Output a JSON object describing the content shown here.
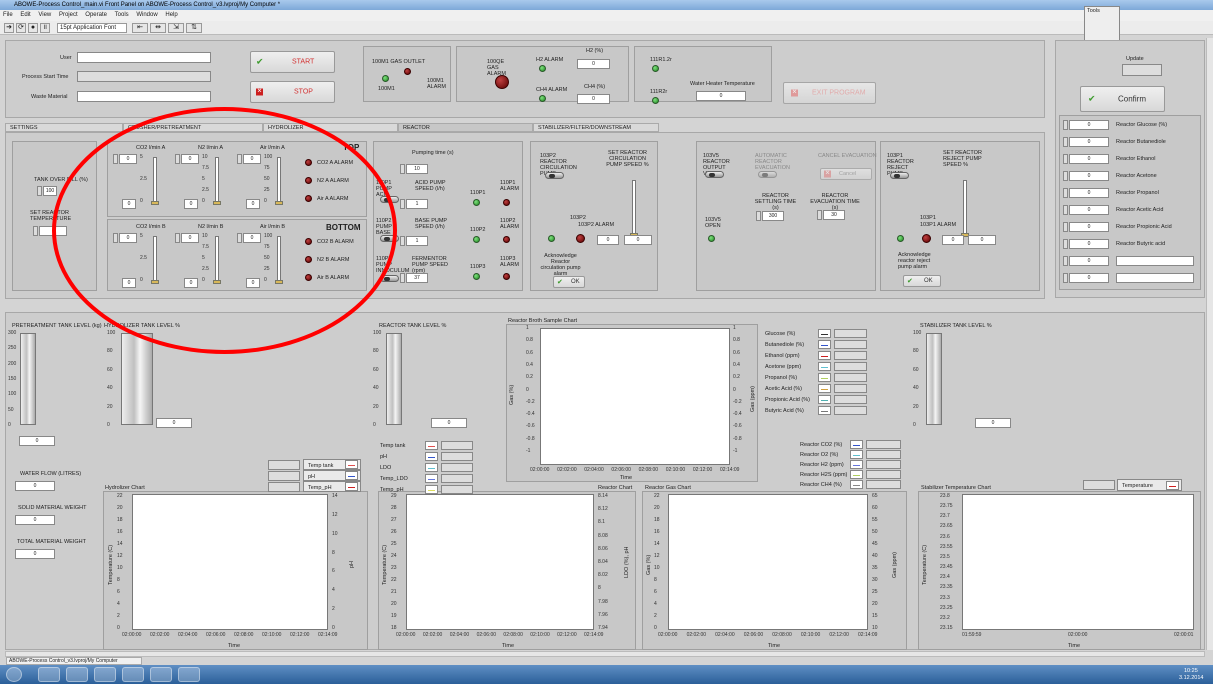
{
  "window": {
    "title": "ABOWE-Process Control_main.vi Front Panel on ABOWE-Process Control_v3.lvproj/My Computer *"
  },
  "menu": [
    "File",
    "Edit",
    "View",
    "Project",
    "Operate",
    "Tools",
    "Window",
    "Help"
  ],
  "toolbar": {
    "font": "15pt Application Font"
  },
  "header": {
    "user_label": "User",
    "start_time_label": "Process Start Time",
    "waste_label": "Waste Material",
    "start_label": "START",
    "stop_label": "STOP",
    "gas_outlet_title": "100M1 GAS OUTLET",
    "gas_outlet_led": "100M1",
    "gas_outlet_alarm": "100M1 ALARM",
    "gas_alarm_title": "100QE GAS ALARM",
    "h2_alarm": "H2 ALARM",
    "h2_pct": "H2 (%)",
    "h2_val": "0",
    "ch4_alarm": "CH4 ALARM",
    "ch4_pct": "CH4 (%)",
    "ch4_val": "0",
    "r111": "111R1.2r",
    "r111b": "111R2r",
    "water_heater": "Water Heater Temperature",
    "water_heater_val": "0",
    "exit_label": "EXIT PROGRAM",
    "update_label": "Update",
    "confirm_label": "Confirm"
  },
  "tabs": [
    "SETTINGS",
    "CRUSHER/PRETREATMENT",
    "HYDROLIZER",
    "REACTOR",
    "STABILIZER/FILTER/DOWNSTREAM CONTAINER"
  ],
  "settings": {
    "tank_over_fill": "TANK OVER FILL (%)",
    "tank_over_fill_val": "100",
    "set_reactor_temp": "SET REACTOR TEMPERATURE"
  },
  "crusher": {
    "top": "TOP",
    "bottom": "BOTTOM",
    "co2a": "CO2 l/min A",
    "n2a": "N2 l/min A",
    "aira": "Air l/min A",
    "co2b": "CO2 l/min B",
    "n2b": "N2 l/min B",
    "airb": "Air l/min B",
    "co2a_alarm": "CO2 A ALARM",
    "n2a_alarm": "N2 A ALARM",
    "aira_alarm": "Air A ALARM",
    "co2b_alarm": "CO2 B ALARM",
    "n2b_alarm": "N2 B ALARM",
    "airb_alarm": "Air B ALARM",
    "scale_a": [
      "5",
      "2.5",
      "0"
    ],
    "scale_b": [
      "10",
      "7.5",
      "5",
      "2.5",
      "0"
    ],
    "scale_c": [
      "100",
      "75",
      "50",
      "25",
      "0"
    ],
    "zero": "0"
  },
  "reactor": {
    "pumping_time": "Pumping time (s)",
    "pumping_val": "10",
    "p1_label": "110P1 PUMP ACID",
    "p1_speed": "ACID PUMP SPEED (l/h)",
    "p1_val": "1",
    "p1_led": "110P1",
    "p1_alarm": "110P1 ALARM",
    "p2_label": "110P2 PUMP BASE",
    "p2_speed": "BASE PUMP SPEED (l/h)",
    "p2_val": "1",
    "p2_led": "110P2",
    "p2_alarm": "110P2 ALARM",
    "p3_label": "110P3 PUMP INNOCULUM",
    "p3_speed": "FERMENTOR PUMP SPEED (rpm)",
    "p3_val": "37",
    "p3_led": "110P3",
    "p3_alarm": "110P3 ALARM",
    "circ_pump": "103P2 REACTOR CIRCULATION PUMP",
    "circ_speed": "SET REACTOR CIRCULATION PUMP SPEED %",
    "circ_led": "103P2",
    "circ_alarm": "103P2 ALARM",
    "circ_v1": "0",
    "circ_v2": "0",
    "ack_circ": "Acknowledge Reactor circulation pump alarm",
    "ok": "OK",
    "out_valve": "103V5 REACTOR OUTPUT VALVE",
    "auto_evac": "AUTOMATIC REACTOR EVACUATION",
    "cancel_evac": "CANCEL EVACUATION",
    "cancel": "Cancel",
    "settle": "REACTOR SETTLING TIME (s)",
    "settle_val": "300",
    "evac_time": "REACTOR EVACUATION TIME (s)",
    "evac_val": "30",
    "v5_open": "103V5 OPEN",
    "reject_pump": "103P1 REACTOR REJECT PUMP",
    "reject_speed": "SET REACTOR REJECT PUMP SPEED %",
    "reject_led": "103P1",
    "reject_alarm": "103P1 ALARM",
    "rej_v1": "0",
    "rej_v2": "0",
    "ack_reject": "Acknowledge reactor reject pump alarm",
    "pct_scale": [
      "100",
      "75",
      "50",
      "25",
      "0"
    ]
  },
  "right_panel": {
    "items": [
      {
        "val": "0",
        "label": "Reactor Glucose (%)"
      },
      {
        "val": "0",
        "label": "Reactor Butanediole"
      },
      {
        "val": "0",
        "label": "Reactor Ethanol"
      },
      {
        "val": "0",
        "label": "Reactor Acetone"
      },
      {
        "val": "0",
        "label": "Reactor Propanol"
      },
      {
        "val": "0",
        "label": "Reactor Acetic Acid"
      },
      {
        "val": "0",
        "label": "Reactor Propionic Acid"
      },
      {
        "val": "0",
        "label": "Reactor Butyric acid"
      },
      {
        "val": "0",
        "label": ""
      },
      {
        "val": "0",
        "label": ""
      }
    ]
  },
  "bottom": {
    "pretreat_tank": "PRETREATMENT TANK LEVEL (kg)",
    "pretreat_scale": [
      "300",
      "250",
      "200",
      "150",
      "100",
      "50",
      "0"
    ],
    "pretreat_val": "0",
    "hydro_tank": "HYDROLIZER TANK LEVEL %",
    "pct_scale": [
      "100",
      "80",
      "60",
      "40",
      "20",
      "0"
    ],
    "hydro_val": "0",
    "water_flow": "WATER FLOW (LITRES)",
    "water_val": "0",
    "solid_weight": "SOLID MATERIAL WEIGHT",
    "solid_val": "0",
    "total_weight": "TOTAL MATERIAL WEIGHT",
    "total_val": "0",
    "hydro_legend": [
      "Temp tank",
      "pH",
      "Temp_pH"
    ],
    "hydro_chart": "Hydrolizer Chart",
    "reactor_tank": "REACTOR TANK LEVEL %",
    "reactor_val": "0",
    "reactor_legend": [
      "Temp tank",
      "pH",
      "LDO",
      "Temp_LDO",
      "Temp_pH"
    ],
    "reactor_chart": "Reactor Chart",
    "broth_chart": "Reactor Broth Sample Chart",
    "broth_legend": [
      "Glucose (%)",
      "Butanediole (%)",
      "Ethanol (ppm)",
      "Acetone (ppm)",
      "Propanol (%)",
      "Acetic Acid (%)",
      "Propionic Acid (%)",
      "Butyric Acid (%)"
    ],
    "gas_legend": [
      "Reactor CO2 (%)",
      "Reactor O2 (%)",
      "Reactor H2 (ppm)",
      "Reactor H2S (ppm)",
      "Reactor CH4 (%)"
    ],
    "gas_chart": "Reactor Gas Chart",
    "stab_tank": "STABILIZER TANK LEVEL %",
    "stab_val": "0",
    "stab_chart": "Stabilizer Temperature Chart",
    "stab_legend": "Temperature",
    "time_label": "Time",
    "temp_axis": "Temperature (C)",
    "ph_axis": "pH",
    "gas_axis": "Gas (%)",
    "gas_ppm": "Gas (ppm)",
    "ldo_axis": "LDO (%), pH",
    "time_ticks": [
      "02:00:00",
      "02:02:00",
      "02:04:00",
      "02:06:00",
      "02:08:00",
      "02:10:00",
      "02:12:00",
      "02:14:09"
    ],
    "stab_ticks": [
      "01:59:59",
      "02:00:00",
      "02:00:01"
    ],
    "hydro_y": [
      "22",
      "20",
      "18",
      "16",
      "14",
      "12",
      "10",
      "8",
      "6",
      "4",
      "2",
      "0"
    ],
    "hydro_y2": [
      "14",
      "12",
      "10",
      "8",
      "6",
      "4",
      "2",
      "0"
    ],
    "reactor_y": [
      "29",
      "28",
      "27",
      "26",
      "25",
      "24",
      "23",
      "22",
      "21",
      "20",
      "19",
      "18"
    ],
    "reactor_y2": [
      "8.14",
      "8.12",
      "8.1",
      "8.08",
      "8.06",
      "8.04",
      "8.02",
      "8",
      "7.98",
      "7.96",
      "7.94"
    ],
    "broth_y": [
      "1",
      "0.8",
      "0.6",
      "0.4",
      "0.2",
      "0",
      "-0.2",
      "-0.4",
      "-0.6",
      "-0.8",
      "-1"
    ],
    "gas_y": [
      "22",
      "20",
      "18",
      "16",
      "14",
      "12",
      "10",
      "8",
      "6",
      "4",
      "2",
      "0"
    ],
    "gas_y2": [
      "65",
      "60",
      "55",
      "50",
      "45",
      "40",
      "35",
      "30",
      "25",
      "20",
      "15",
      "10"
    ],
    "stab_y": [
      "23.8",
      "23.75",
      "23.7",
      "23.65",
      "23.6",
      "23.55",
      "23.5",
      "23.45",
      "23.4",
      "23.35",
      "23.3",
      "23.25",
      "23.2",
      "23.15"
    ]
  },
  "status": {
    "project_tab": "ABOWE-Process Control_v3.lvproj/My Computer",
    "clock": "10:25",
    "date": "3.12.2014"
  },
  "colors": {
    "alarm_red": "#8b0000",
    "led_green": "#1f8a1f",
    "annotation": "#ff0000",
    "start_text": "#d23030"
  }
}
